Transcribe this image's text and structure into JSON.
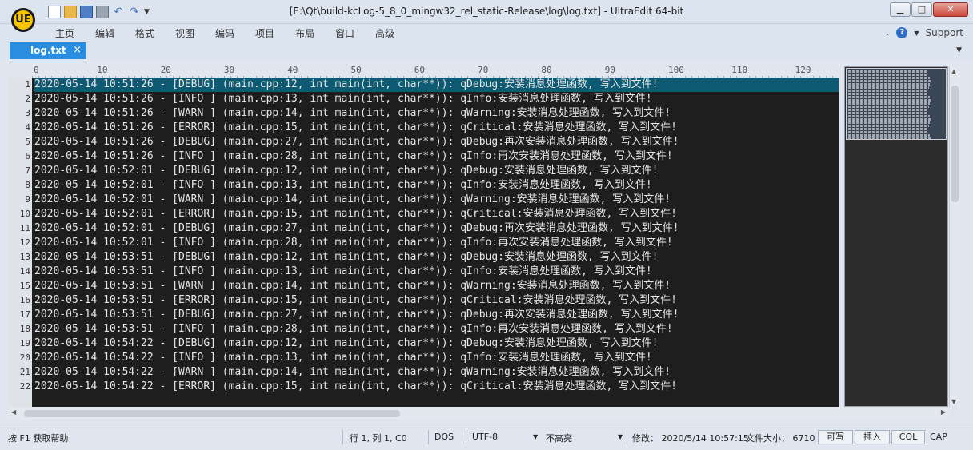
{
  "app": {
    "logo_text": "UE",
    "title": "[E:\\Qt\\build-kcLog-5_8_0_mingw32_rel_static-Release\\log\\log.txt] - UltraEdit 64-bit"
  },
  "window_controls": {
    "minimize": "▁",
    "maximize": "□",
    "close": "✕"
  },
  "quick_access": {
    "icons": [
      "new-file-icon",
      "open-folder-icon",
      "save-icon",
      "print-icon",
      "undo-icon",
      "redo-icon",
      "customize-dropdown-icon"
    ],
    "undo": "↶",
    "redo": "↷",
    "more": "▼"
  },
  "menu": {
    "items": [
      "主页",
      "编辑",
      "格式",
      "视图",
      "编码",
      "项目",
      "布局",
      "窗口",
      "高级"
    ],
    "help": "?",
    "support": "Support",
    "arrow": "▼",
    "collapse": "⌄"
  },
  "tabs": [
    {
      "label": "log.txt",
      "close": "×"
    }
  ],
  "tab_dropdown": "▼",
  "ruler": {
    "ticks": [
      "0",
      "10",
      "20",
      "30",
      "40",
      "50",
      "60",
      "70",
      "80",
      "90",
      "100",
      "110",
      "120"
    ]
  },
  "editor": {
    "colors": {
      "background": "#1e1e1e",
      "current_line": "#0e5a72",
      "text": "#e6e6e6",
      "gutter": "#dfe3e8"
    },
    "current_line": 1,
    "lines": [
      "2020-05-14 10:51:26 - [DEBUG] (main.cpp:12, int main(int, char**)): qDebug:安装消息处理函数, 写入到文件!",
      "2020-05-14 10:51:26 - [INFO ] (main.cpp:13, int main(int, char**)): qInfo:安装消息处理函数, 写入到文件!",
      "2020-05-14 10:51:26 - [WARN ] (main.cpp:14, int main(int, char**)): qWarning:安装消息处理函数, 写入到文件!",
      "2020-05-14 10:51:26 - [ERROR] (main.cpp:15, int main(int, char**)): qCritical:安装消息处理函数, 写入到文件!",
      "2020-05-14 10:51:26 - [DEBUG] (main.cpp:27, int main(int, char**)): qDebug:再次安装消息处理函数, 写入到文件!",
      "2020-05-14 10:51:26 - [INFO ] (main.cpp:28, int main(int, char**)): qInfo:再次安装消息处理函数, 写入到文件!",
      "2020-05-14 10:52:01 - [DEBUG] (main.cpp:12, int main(int, char**)): qDebug:安装消息处理函数, 写入到文件!",
      "2020-05-14 10:52:01 - [INFO ] (main.cpp:13, int main(int, char**)): qInfo:安装消息处理函数, 写入到文件!",
      "2020-05-14 10:52:01 - [WARN ] (main.cpp:14, int main(int, char**)): qWarning:安装消息处理函数, 写入到文件!",
      "2020-05-14 10:52:01 - [ERROR] (main.cpp:15, int main(int, char**)): qCritical:安装消息处理函数, 写入到文件!",
      "2020-05-14 10:52:01 - [DEBUG] (main.cpp:27, int main(int, char**)): qDebug:再次安装消息处理函数, 写入到文件!",
      "2020-05-14 10:52:01 - [INFO ] (main.cpp:28, int main(int, char**)): qInfo:再次安装消息处理函数, 写入到文件!",
      "2020-05-14 10:53:51 - [DEBUG] (main.cpp:12, int main(int, char**)): qDebug:安装消息处理函数, 写入到文件!",
      "2020-05-14 10:53:51 - [INFO ] (main.cpp:13, int main(int, char**)): qInfo:安装消息处理函数, 写入到文件!",
      "2020-05-14 10:53:51 - [WARN ] (main.cpp:14, int main(int, char**)): qWarning:安装消息处理函数, 写入到文件!",
      "2020-05-14 10:53:51 - [ERROR] (main.cpp:15, int main(int, char**)): qCritical:安装消息处理函数, 写入到文件!",
      "2020-05-14 10:53:51 - [DEBUG] (main.cpp:27, int main(int, char**)): qDebug:再次安装消息处理函数, 写入到文件!",
      "2020-05-14 10:53:51 - [INFO ] (main.cpp:28, int main(int, char**)): qInfo:再次安装消息处理函数, 写入到文件!",
      "2020-05-14 10:54:22 - [DEBUG] (main.cpp:12, int main(int, char**)): qDebug:安装消息处理函数, 写入到文件!",
      "2020-05-14 10:54:22 - [INFO ] (main.cpp:13, int main(int, char**)): qInfo:安装消息处理函数, 写入到文件!",
      "2020-05-14 10:54:22 - [WARN ] (main.cpp:14, int main(int, char**)): qWarning:安装消息处理函数, 写入到文件!",
      "2020-05-14 10:54:22 - [ERROR] (main.cpp:15, int main(int, char**)): qCritical:安装消息处理函数, 写入到文件!"
    ]
  },
  "scrollbars": {
    "up": "▲",
    "down": "▼",
    "left": "◀",
    "right": "▶"
  },
  "statusbar": {
    "help": "按 F1 获取帮助",
    "position": "行 1, 列 1, C0",
    "line_ending": "DOS",
    "encoding": "UTF-8",
    "highlight": "不高亮",
    "modified": "修改： 2020/5/14 10:57:15",
    "file_size": "文件大小： 6710",
    "writable": "可写",
    "insert": "插入",
    "col": "COL",
    "cap": "CAP",
    "dropdown": "▼"
  }
}
